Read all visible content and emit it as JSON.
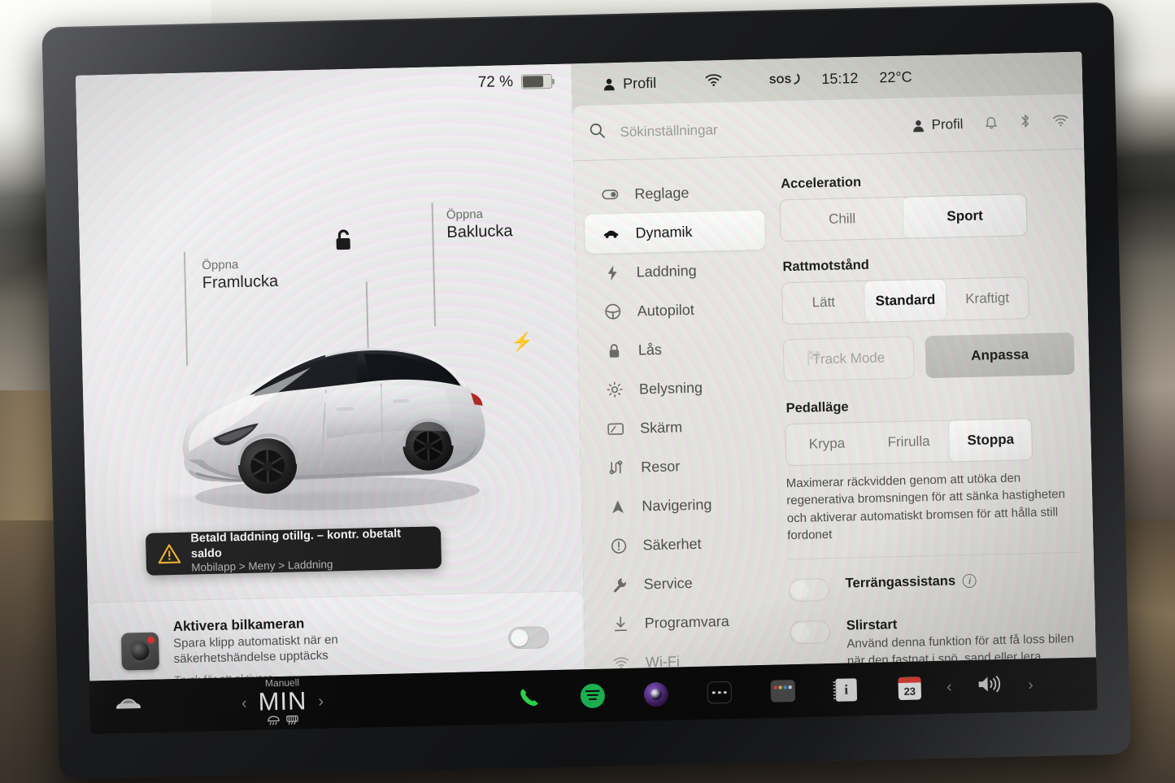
{
  "vehicle_panel": {
    "battery_percent": "72 %",
    "battery_level": 72,
    "callouts": [
      {
        "kicker": "Öppna",
        "main": "Framlucka"
      },
      {
        "kicker": "Öppna",
        "main": "Baklucka"
      }
    ],
    "lock_state_icon": "unlocked-padlock-icon",
    "charge_port_icon": "charge-bolt-icon",
    "toast": {
      "title": "Betald laddning otillg. – kontr. obetalt saldo",
      "subtitle": "Mobilapp > Meny > Laddning",
      "icon": "warning-triangle-icon"
    },
    "dashcam": {
      "title": "Aktivera bilkameran",
      "subtitle": "Spara klipp automatiskt när en säkerhetshändelse upptäcks",
      "hint": "Tryck för att aktivera",
      "toggle_on": false,
      "icon": "dashcam-icon"
    }
  },
  "statusbar": {
    "profile_label": "Profil",
    "profile_icon": "person-icon",
    "wifi_icon": "wifi-icon",
    "sos_label": "SOS",
    "time": "15:12",
    "temperature": "22°C"
  },
  "search": {
    "placeholder": "Sökinställningar",
    "value": "",
    "icon": "search-icon",
    "profile_label": "Profil",
    "right_icons": [
      "person-icon",
      "bell-icon",
      "bluetooth-icon",
      "wifi-icon"
    ]
  },
  "sidebar": {
    "items": [
      {
        "label": "Reglage",
        "icon": "toggle-switch-icon",
        "active": false
      },
      {
        "label": "Dynamik",
        "icon": "car-side-icon",
        "active": true
      },
      {
        "label": "Laddning",
        "icon": "bolt-icon",
        "active": false
      },
      {
        "label": "Autopilot",
        "icon": "steering-wheel-icon",
        "active": false
      },
      {
        "label": "Lås",
        "icon": "lock-icon",
        "active": false
      },
      {
        "label": "Belysning",
        "icon": "sun-brightness-icon",
        "active": false
      },
      {
        "label": "Skärm",
        "icon": "display-icon",
        "active": false
      },
      {
        "label": "Resor",
        "icon": "trips-icon",
        "active": false
      },
      {
        "label": "Navigering",
        "icon": "navigation-arrow-icon",
        "active": false
      },
      {
        "label": "Säkerhet",
        "icon": "exclamation-circle-icon",
        "active": false
      },
      {
        "label": "Service",
        "icon": "wrench-icon",
        "active": false
      },
      {
        "label": "Programvara",
        "icon": "download-icon",
        "active": false
      },
      {
        "label": "Wi-Fi",
        "icon": "wifi-icon",
        "active": false
      }
    ]
  },
  "content": {
    "acceleration": {
      "label": "Acceleration",
      "options": [
        "Chill",
        "Sport"
      ],
      "selected": "Sport"
    },
    "steering": {
      "label": "Rattmotstånd",
      "options": [
        "Lätt",
        "Standard",
        "Kraftigt"
      ],
      "selected": "Standard"
    },
    "track_mode": {
      "label": "Track Mode",
      "icon": "checkered-flag-icon",
      "enabled": false,
      "customize_label": "Anpassa"
    },
    "pedal": {
      "label": "Pedalläge",
      "options": [
        "Krypa",
        "Frirulla",
        "Stoppa"
      ],
      "selected": "Stoppa",
      "description": "Maximerar räckvidden genom att utöka den regenerativa bromsningen för att sänka hastigheten och aktiverar automatiskt bromsen för att hålla still fordonet"
    },
    "offroad_assist": {
      "title": "Terrängassistans",
      "info_icon": "info-circle-icon",
      "toggle_on": false
    },
    "slip_start": {
      "title": "Slirstart",
      "subtitle": "Använd denna funktion för att få loss bilen när den fastnat i snö, sand eller lera",
      "toggle_on": false
    }
  },
  "bottombar": {
    "car_icon": "car-front-icon",
    "climate": {
      "mode_label": "Manuell",
      "temperature": "MIN",
      "prev_icon": "chevron-left-icon",
      "next_icon": "chevron-right-icon",
      "defrost_front_icon": "defrost-front-icon",
      "defrost_rear_icon": "defrost-rear-icon"
    },
    "apps": [
      {
        "name": "phone-app-icon"
      },
      {
        "name": "spotify-app-icon"
      },
      {
        "name": "camera-app-icon"
      },
      {
        "name": "more-apps-icon"
      },
      {
        "name": "calculator-app-icon"
      },
      {
        "name": "owners-manual-icon"
      },
      {
        "name": "calendar-app-icon",
        "badge": "23"
      }
    ],
    "volume": {
      "icon": "volume-icon",
      "prev_icon": "chevron-left-icon",
      "next_icon": "chevron-right-icon"
    }
  },
  "colors": {
    "accent_green": "#1DB954",
    "warning_amber": "#f0b429",
    "alert_red": "#e8312a",
    "panel_light": "#ecebe9",
    "panel_dark": "#0a0a0a"
  }
}
